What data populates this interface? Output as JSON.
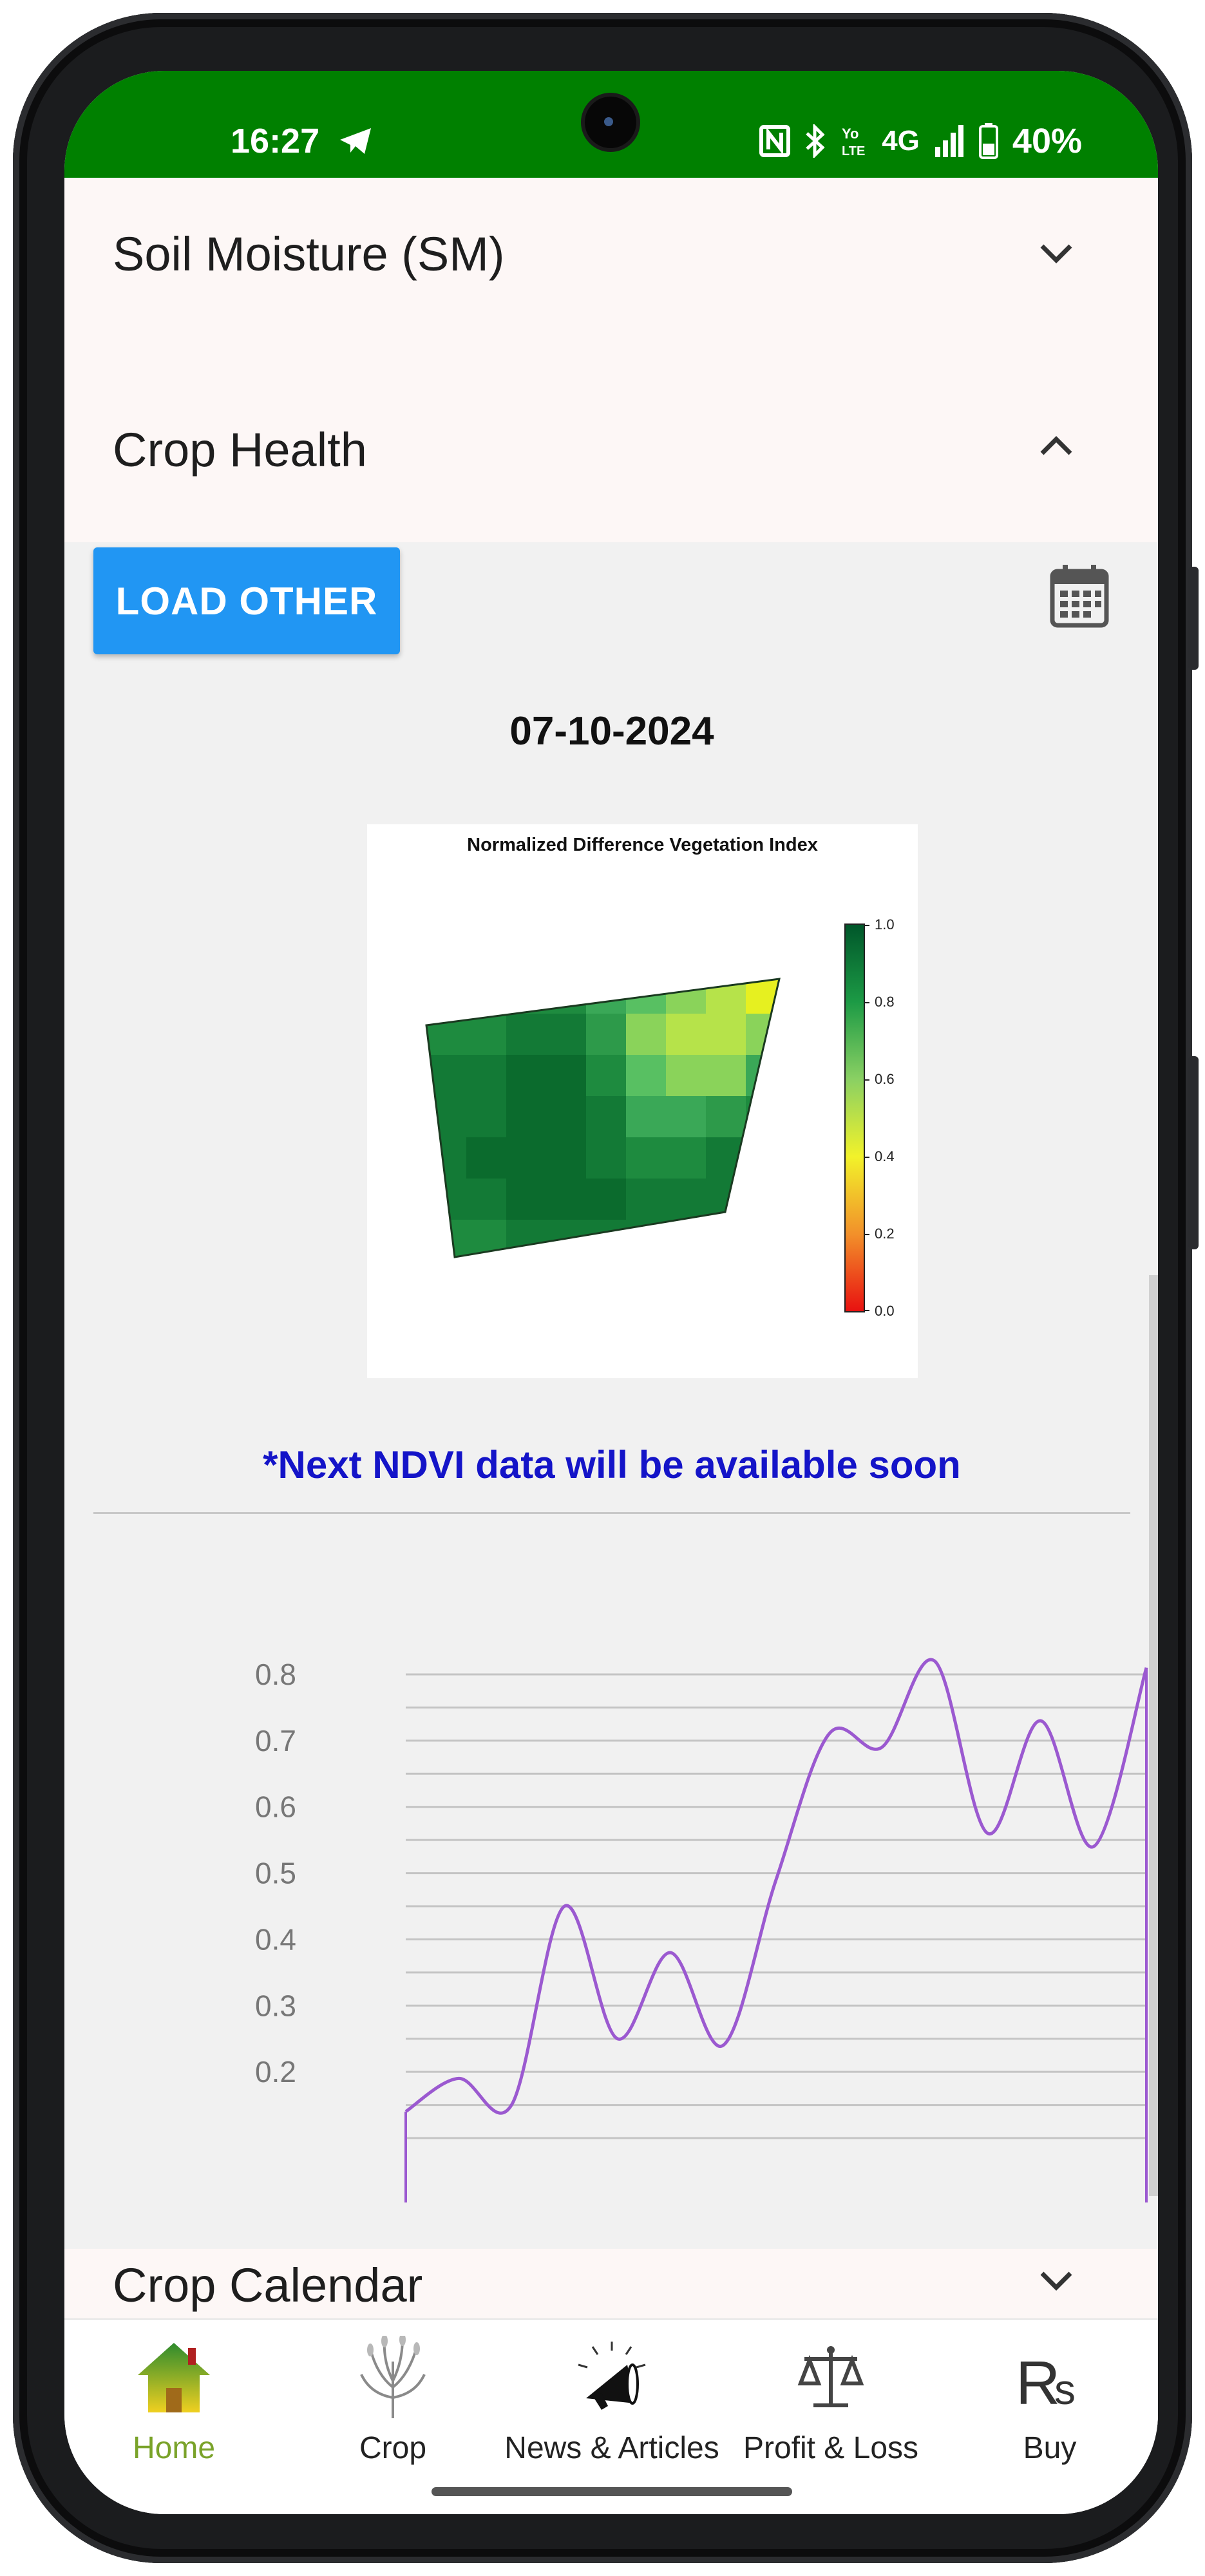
{
  "status_bar": {
    "time": "16:27",
    "battery": "40%",
    "network": "4G",
    "icons": [
      "telegram-icon",
      "nfc-icon",
      "bluetooth-icon",
      "volte-icon",
      "signal-icon",
      "battery-icon"
    ]
  },
  "sections": {
    "soil_moisture": {
      "title": "Soil Moisture (SM)"
    },
    "crop_health": {
      "title": "Crop Health"
    },
    "crop_calendar": {
      "title": "Crop Calendar"
    }
  },
  "crop_health": {
    "load_button": "LOAD OTHER",
    "date": "07-10-2024",
    "ndvi_image": {
      "title": "Normalized Difference Vegetation Index",
      "colorbar_ticks": [
        "1.0",
        "0.8",
        "0.6",
        "0.4",
        "0.2",
        "0.0"
      ]
    },
    "note": "*Next NDVI data will be available soon"
  },
  "chart_data": {
    "type": "line",
    "title": "",
    "xlabel": "",
    "ylabel": "",
    "y_tick_labels": [
      "0.8",
      "0.7",
      "0.6",
      "0.5",
      "0.4",
      "0.3",
      "0.2"
    ],
    "ylim": [
      0.1,
      0.8
    ],
    "grid": true,
    "series": [
      {
        "values": [
          0.14,
          0.19,
          0.15,
          0.45,
          0.25,
          0.38,
          0.24,
          0.49,
          0.71,
          0.69,
          0.82,
          0.56,
          0.73,
          0.54,
          0.81
        ]
      }
    ]
  },
  "bottom_nav": {
    "items": [
      {
        "label": "Home",
        "icon": "home-icon",
        "active": true
      },
      {
        "label": "Crop",
        "icon": "crop-icon",
        "active": false
      },
      {
        "label": "News & Articles",
        "icon": "megaphone-icon",
        "active": false
      },
      {
        "label": "Profit & Loss",
        "icon": "scale-icon",
        "active": false
      },
      {
        "label": "Buy",
        "icon": "rupee-icon",
        "active": false
      }
    ]
  },
  "colors": {
    "status_bar": "#008000",
    "button": "#2196f3",
    "note_text": "#1414c8",
    "line": "#9b59d0",
    "nav_active": "#7aa32a"
  }
}
